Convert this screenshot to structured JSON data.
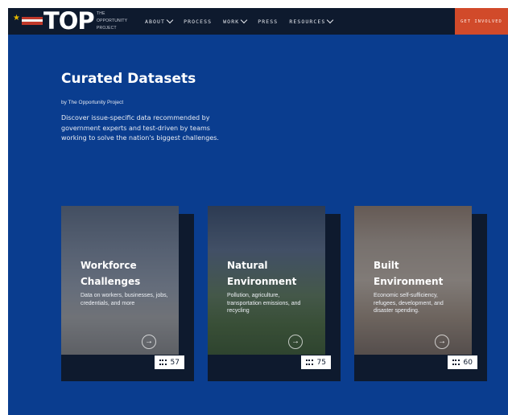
{
  "nav": {
    "logo": "TOP",
    "logo_sub": [
      "THE",
      "OPPORTUNITY",
      "PROJECT"
    ],
    "items": [
      {
        "label": "ABOUT",
        "has_dropdown": true
      },
      {
        "label": "PROCESS",
        "has_dropdown": false
      },
      {
        "label": "WORK",
        "has_dropdown": true
      },
      {
        "label": "PRESS",
        "has_dropdown": false
      },
      {
        "label": "RESOURCES",
        "has_dropdown": true
      }
    ],
    "cta": "GET INVOLVED"
  },
  "hero": {
    "title": "Curated Datasets",
    "byline": "by The Opportunity Project",
    "description": "Discover issue-specific data recommended by government experts and test-driven by teams working to solve the nation's biggest challenges."
  },
  "cards": [
    {
      "title": "Workforce Challenges",
      "description": "Data on workers, businesses, jobs, credentials, and more",
      "count": "57"
    },
    {
      "title": "Natural Environment",
      "description": "Pollution, agriculture, transportation emissions, and recycling",
      "count": "75"
    },
    {
      "title": "Built Environment",
      "description": "Economic self-sufficiency, refugees, development, and disaster spending.",
      "count": "60"
    }
  ],
  "icons": {
    "arrow": "→",
    "star": "★"
  },
  "colors": {
    "background": "#0a3d8f",
    "nav": "#0e1a2e",
    "cta": "#d14a2a"
  }
}
